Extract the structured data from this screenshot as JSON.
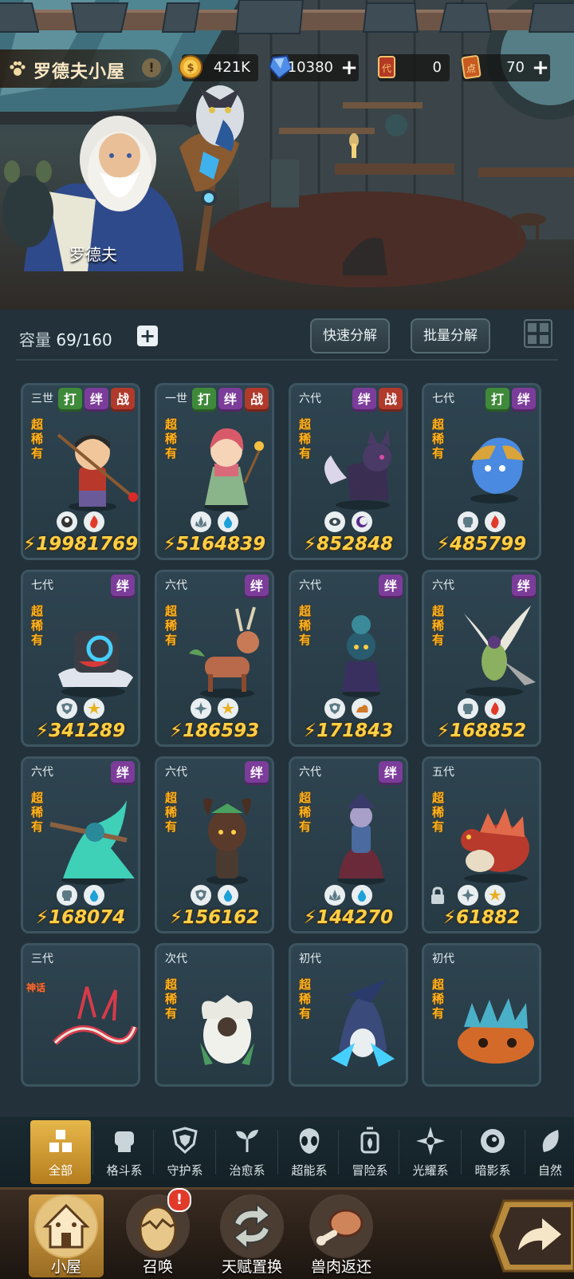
{
  "header": {
    "title": "罗德夫小屋",
    "npc_name": "罗德夫",
    "resources": [
      {
        "icon": "gold-coin-icon",
        "value": "421K",
        "has_plus": false
      },
      {
        "icon": "blue-crystal-icon",
        "value": "10380",
        "has_plus": true
      },
      {
        "icon": "red-ticket-icon",
        "value": "0",
        "has_plus": false
      },
      {
        "icon": "red-card-icon",
        "value": "70",
        "has_plus": true
      }
    ]
  },
  "inventory": {
    "capacity_label": "容量",
    "capacity_value": "69/160",
    "quick_decompose": "快速分解",
    "batch_decompose": "批量分解"
  },
  "cards": [
    {
      "gen": "三世",
      "tags": [
        "打",
        "绊",
        "战"
      ],
      "rarity": "超稀有",
      "elems": [
        "ultra",
        "fire"
      ],
      "power": "19981769",
      "creature": "boy-warrior"
    },
    {
      "gen": "一世",
      "tags": [
        "打",
        "绊",
        "战"
      ],
      "rarity": "超稀有",
      "elems": [
        "heal",
        "water"
      ],
      "power": "5164839",
      "creature": "girl-mage"
    },
    {
      "gen": "六代",
      "tags": [
        "绊",
        "战"
      ],
      "rarity": "超稀有",
      "elems": [
        "dark",
        "moon"
      ],
      "power": "852848",
      "creature": "shadow-fox"
    },
    {
      "gen": "七代",
      "tags": [
        "打",
        "绊"
      ],
      "rarity": "超稀有",
      "elems": [
        "fight",
        "fire"
      ],
      "power": "485799",
      "creature": "blue-flame-beast"
    },
    {
      "gen": "七代",
      "tags": [
        "绊"
      ],
      "rarity": "超稀有",
      "elems": [
        "guard",
        "sun"
      ],
      "power": "341289",
      "creature": "shield-golem"
    },
    {
      "gen": "六代",
      "tags": [
        "绊"
      ],
      "rarity": "超稀有",
      "elems": [
        "light",
        "sun"
      ],
      "power": "186593",
      "creature": "deer"
    },
    {
      "gen": "六代",
      "tags": [
        "绊"
      ],
      "rarity": "超稀有",
      "elems": [
        "guard",
        "earth"
      ],
      "power": "171843",
      "creature": "rose-witch"
    },
    {
      "gen": "六代",
      "tags": [
        "绊"
      ],
      "rarity": "超稀有",
      "elems": [
        "fight",
        "fire"
      ],
      "power": "168852",
      "creature": "mantis"
    },
    {
      "gen": "六代",
      "tags": [
        "绊"
      ],
      "rarity": "超稀有",
      "elems": [
        "fight",
        "water"
      ],
      "power": "168074",
      "creature": "water-spirit"
    },
    {
      "gen": "六代",
      "tags": [
        "绊"
      ],
      "rarity": "超稀有",
      "elems": [
        "guard",
        "water"
      ],
      "power": "156162",
      "creature": "tree-sprite"
    },
    {
      "gen": "六代",
      "tags": [
        "绊"
      ],
      "rarity": "超稀有",
      "elems": [
        "heal",
        "water"
      ],
      "power": "144270",
      "creature": "coral-queen"
    },
    {
      "gen": "五代",
      "tags": [],
      "rarity": "超稀有",
      "elems": [
        "light",
        "sun"
      ],
      "power": "61882",
      "creature": "red-turtle",
      "locked": true
    },
    {
      "gen": "三代",
      "tags": [],
      "rarity": "神话",
      "elems": [],
      "power": "",
      "creature": "bone-dragon"
    },
    {
      "gen": "次代",
      "tags": [],
      "rarity": "超稀有",
      "elems": [],
      "power": "",
      "creature": "white-owl"
    },
    {
      "gen": "初代",
      "tags": [],
      "rarity": "超稀有",
      "elems": [],
      "power": "",
      "creature": "shark-knight"
    },
    {
      "gen": "初代",
      "tags": [],
      "rarity": "超稀有",
      "elems": [],
      "power": "",
      "creature": "rock-crab"
    }
  ],
  "categories": [
    {
      "label": "全部",
      "icon": "all-blocks-icon",
      "active": true
    },
    {
      "label": "格斗系",
      "icon": "fist-icon"
    },
    {
      "label": "守护系",
      "icon": "shield-icon"
    },
    {
      "label": "治愈系",
      "icon": "sprout-icon"
    },
    {
      "label": "超能系",
      "icon": "alien-icon"
    },
    {
      "label": "冒险系",
      "icon": "lantern-icon"
    },
    {
      "label": "光耀系",
      "icon": "star-cross-icon"
    },
    {
      "label": "暗影系",
      "icon": "eye-icon"
    },
    {
      "label": "自然",
      "icon": "leaf-icon"
    }
  ],
  "nav": [
    {
      "label": "小屋",
      "icon": "hut-icon",
      "active": true
    },
    {
      "label": "召唤",
      "icon": "egg-icon",
      "badge": "!"
    },
    {
      "label": "天赋置换",
      "icon": "swap-arrows-icon"
    },
    {
      "label": "兽肉返还",
      "icon": "meat-icon"
    }
  ],
  "colors": {
    "power": "#ffcf45",
    "rarity": "#ffb21e",
    "tag_da": "#3f8a3a",
    "tag_ban": "#7c3c9a",
    "tag_zhan": "#b03a2c",
    "accent_gold": "#d6a44a"
  }
}
